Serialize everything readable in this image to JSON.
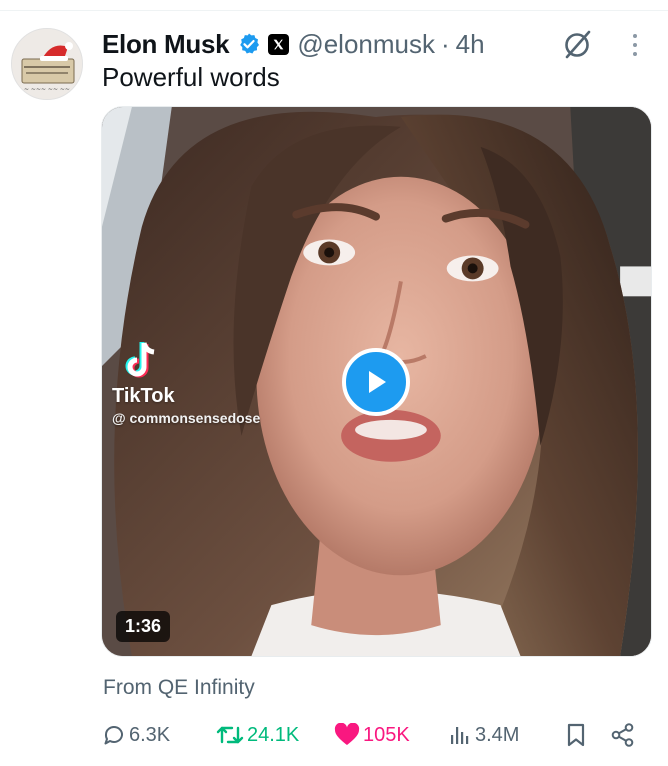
{
  "tweet": {
    "author_name": "Elon Musk",
    "handle": "@elonmusk",
    "separator": "·",
    "time": "4h",
    "text": "Powerful words"
  },
  "media": {
    "watermark_brand": "TikTok",
    "watermark_user": "@ commonsensedose",
    "duration": "1:36"
  },
  "source": "From QE Infinity",
  "actions": {
    "replies": "6.3K",
    "reposts": "24.1K",
    "likes": "105K",
    "views": "3.4M"
  },
  "icons": {
    "verified": "verified-badge-icon",
    "affiliate": "x-logo-icon",
    "grok": "grok-icon",
    "more": "more-vertical-icon",
    "play": "play-icon",
    "reply": "reply-icon",
    "repost": "repost-icon",
    "like": "heart-icon",
    "views": "views-icon",
    "bookmark": "bookmark-icon",
    "share": "share-icon"
  },
  "colors": {
    "verified": "#1d9bf0",
    "repost_active": "#00ba7c",
    "like_active": "#f91880",
    "secondary_text": "#536471",
    "play_button": "#1d9bf0"
  }
}
